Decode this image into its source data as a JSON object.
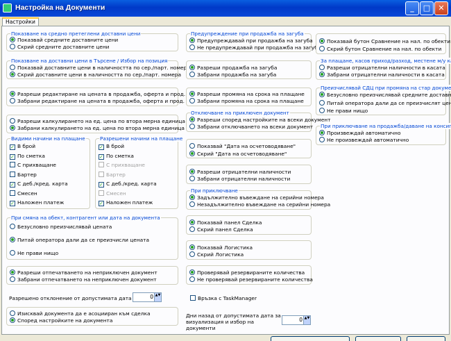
{
  "window": {
    "title": "Настройка на Документи",
    "minimize": "_",
    "maximize": "□",
    "close": "✕"
  },
  "tab": "Настройки",
  "g1": {
    "title": "Показване на средно претеглени доставни цени",
    "o1": "Показвай средните доставните цени",
    "o2": "Скрий средните доставните цени",
    "selected": 1
  },
  "g2": {
    "title": "Показване на доставни цени в Търсене / Избор на позиция",
    "o1": "Показвай доставните цени в наличността по сер./парт. номера",
    "o2": "Скрий доставните цени в наличността по сер./парт. номера",
    "selected": 2
  },
  "g3": {
    "o1": "Разреши редактиране на цената в продажба, оферта и прод. на консигн.",
    "o2": "Забрани редактиране на цената в продажба, оферта и прод. на консигн.",
    "selected": 1
  },
  "g4": {
    "o1": "Разреши калкулирането на ед. цена по втора мерна единица",
    "o2": "Забрани калкулирането на ед. цена по втора мерна единица",
    "selected": 2
  },
  "visible_payments": {
    "title": "Видими начини на плащане",
    "items": [
      {
        "label": "В брой",
        "checked": true
      },
      {
        "label": "По сметка",
        "checked": true
      },
      {
        "label": "С прихващане",
        "checked": false
      },
      {
        "label": "Бартер",
        "checked": false
      },
      {
        "label": "С деб./кред. карта",
        "checked": true
      },
      {
        "label": "Смесен",
        "checked": false
      },
      {
        "label": "Наложен платеж",
        "checked": true
      }
    ]
  },
  "allowed_payments": {
    "title": "Разрешени начини на плащане",
    "items": [
      {
        "label": "В брой",
        "checked": true,
        "disabled": false
      },
      {
        "label": "По сметка",
        "checked": true,
        "disabled": false
      },
      {
        "label": "С прихващане",
        "checked": false,
        "disabled": true
      },
      {
        "label": "Бартер",
        "checked": false,
        "disabled": true
      },
      {
        "label": "С деб./кред. карта",
        "checked": true,
        "disabled": false
      },
      {
        "label": "Смесен",
        "checked": false,
        "disabled": true
      },
      {
        "label": "Наложен платеж",
        "checked": true,
        "disabled": false
      }
    ]
  },
  "g_object": {
    "title": "При смяна на обект, контрагент или дата на документа",
    "o1": "Безусловно преизчислявай цената",
    "o2": "Питай оператора дали да се преизчисли цената",
    "o3": "Не прави нищо",
    "selected": 2
  },
  "g_print": {
    "o1": "Разреши отпечатването на неприключен документ",
    "o2": "Забрани отпечатването на неприключен документ",
    "selected": 1
  },
  "date_deviation": {
    "label": "Разрешено отклонение от допустимата дата в дни:",
    "value": "0",
    "arrows": "▲▼"
  },
  "g_deal": {
    "o1": "Изисквай документа да е асоцииран към сделка",
    "o2": "Според настройките на документа",
    "selected": 2
  },
  "g_loss": {
    "title": "Предупреждение при продажба на загуба",
    "o1": "Предупреждавай при продажба на загуба",
    "o2": "Не предупреждавай при продажба на загуба",
    "selected": 1
  },
  "g_loss2": {
    "o1": "Разреши продажба на загуба",
    "o2": "Забрани продажба на загуба",
    "selected": 1
  },
  "g_term": {
    "o1": "Разреши промяна на срока на плащане",
    "o2": "Забрани промяна на срока на плащане",
    "selected": 1
  },
  "g_reject": {
    "title": "Отключване на приключен документ",
    "o1": "Разреши според настройките на всеки документ",
    "o2": "Забрани отключването на всеки документ",
    "selected": 1
  },
  "g_valdate": {
    "o1": "Показвай \"Дата на осчетоводяване\"",
    "o2": "Скрий \"Дата на осчетоводяване\"",
    "selected": 2
  },
  "g_negqty": {
    "o1": "Разреши отрицателни наличности",
    "o2": "Забрани отрицателни наличности",
    "selected": 1
  },
  "g_close": {
    "title": "При приключване",
    "o1": "Задължително въвеждане на серийни номера",
    "o2": "Незадължително въвеждане на серийни номера",
    "selected": 1
  },
  "g_dealpanel": {
    "o1": "Показвай панел Сделка",
    "o2": "Скрий панел Сделка",
    "selected": 1
  },
  "g_logistics": {
    "o1": "Показвай Логистика",
    "o2": "Скрий Логистика",
    "selected": 1
  },
  "g_reserve": {
    "o1": "Проверявай резервираните количества",
    "o2": "Не проверявай резервираните количества",
    "selected": 1
  },
  "taskmanager": {
    "label": "Връзка с TaskManager",
    "checked": false
  },
  "days_back": {
    "label": "Дни назад от допустимата дата за визуализация и избор на документи",
    "value": "0",
    "arrows": "▲▼"
  },
  "g_compare": {
    "o1": "Показвай бутон Сравнение на нал. по обекти",
    "o2": "Скрий бутон Сравнение на нал. по обекти",
    "selected": 1
  },
  "g_cash": {
    "title": "За плащане, касов приход/разход, местене м/у каси",
    "o1": "Разреши отрицателни наличности в касата",
    "o2": "Забрани отрицателни наличности в касата",
    "selected": 2
  },
  "g_recalc": {
    "title": "Преизчислявай СДЦ при промяна на стар документ",
    "o1": "Безусловно преизчислявай средните доставни цени",
    "o2": "Питай оператора дали да се преизчислят цените",
    "o3": "Не прави нищо",
    "selected": 1
  },
  "g_consign": {
    "title": "При приключване на продажба/даване на консигнация",
    "o1": "Произвеждай автоматично",
    "o2": "Не произвеждай автоматично",
    "selected": 1
  }
}
